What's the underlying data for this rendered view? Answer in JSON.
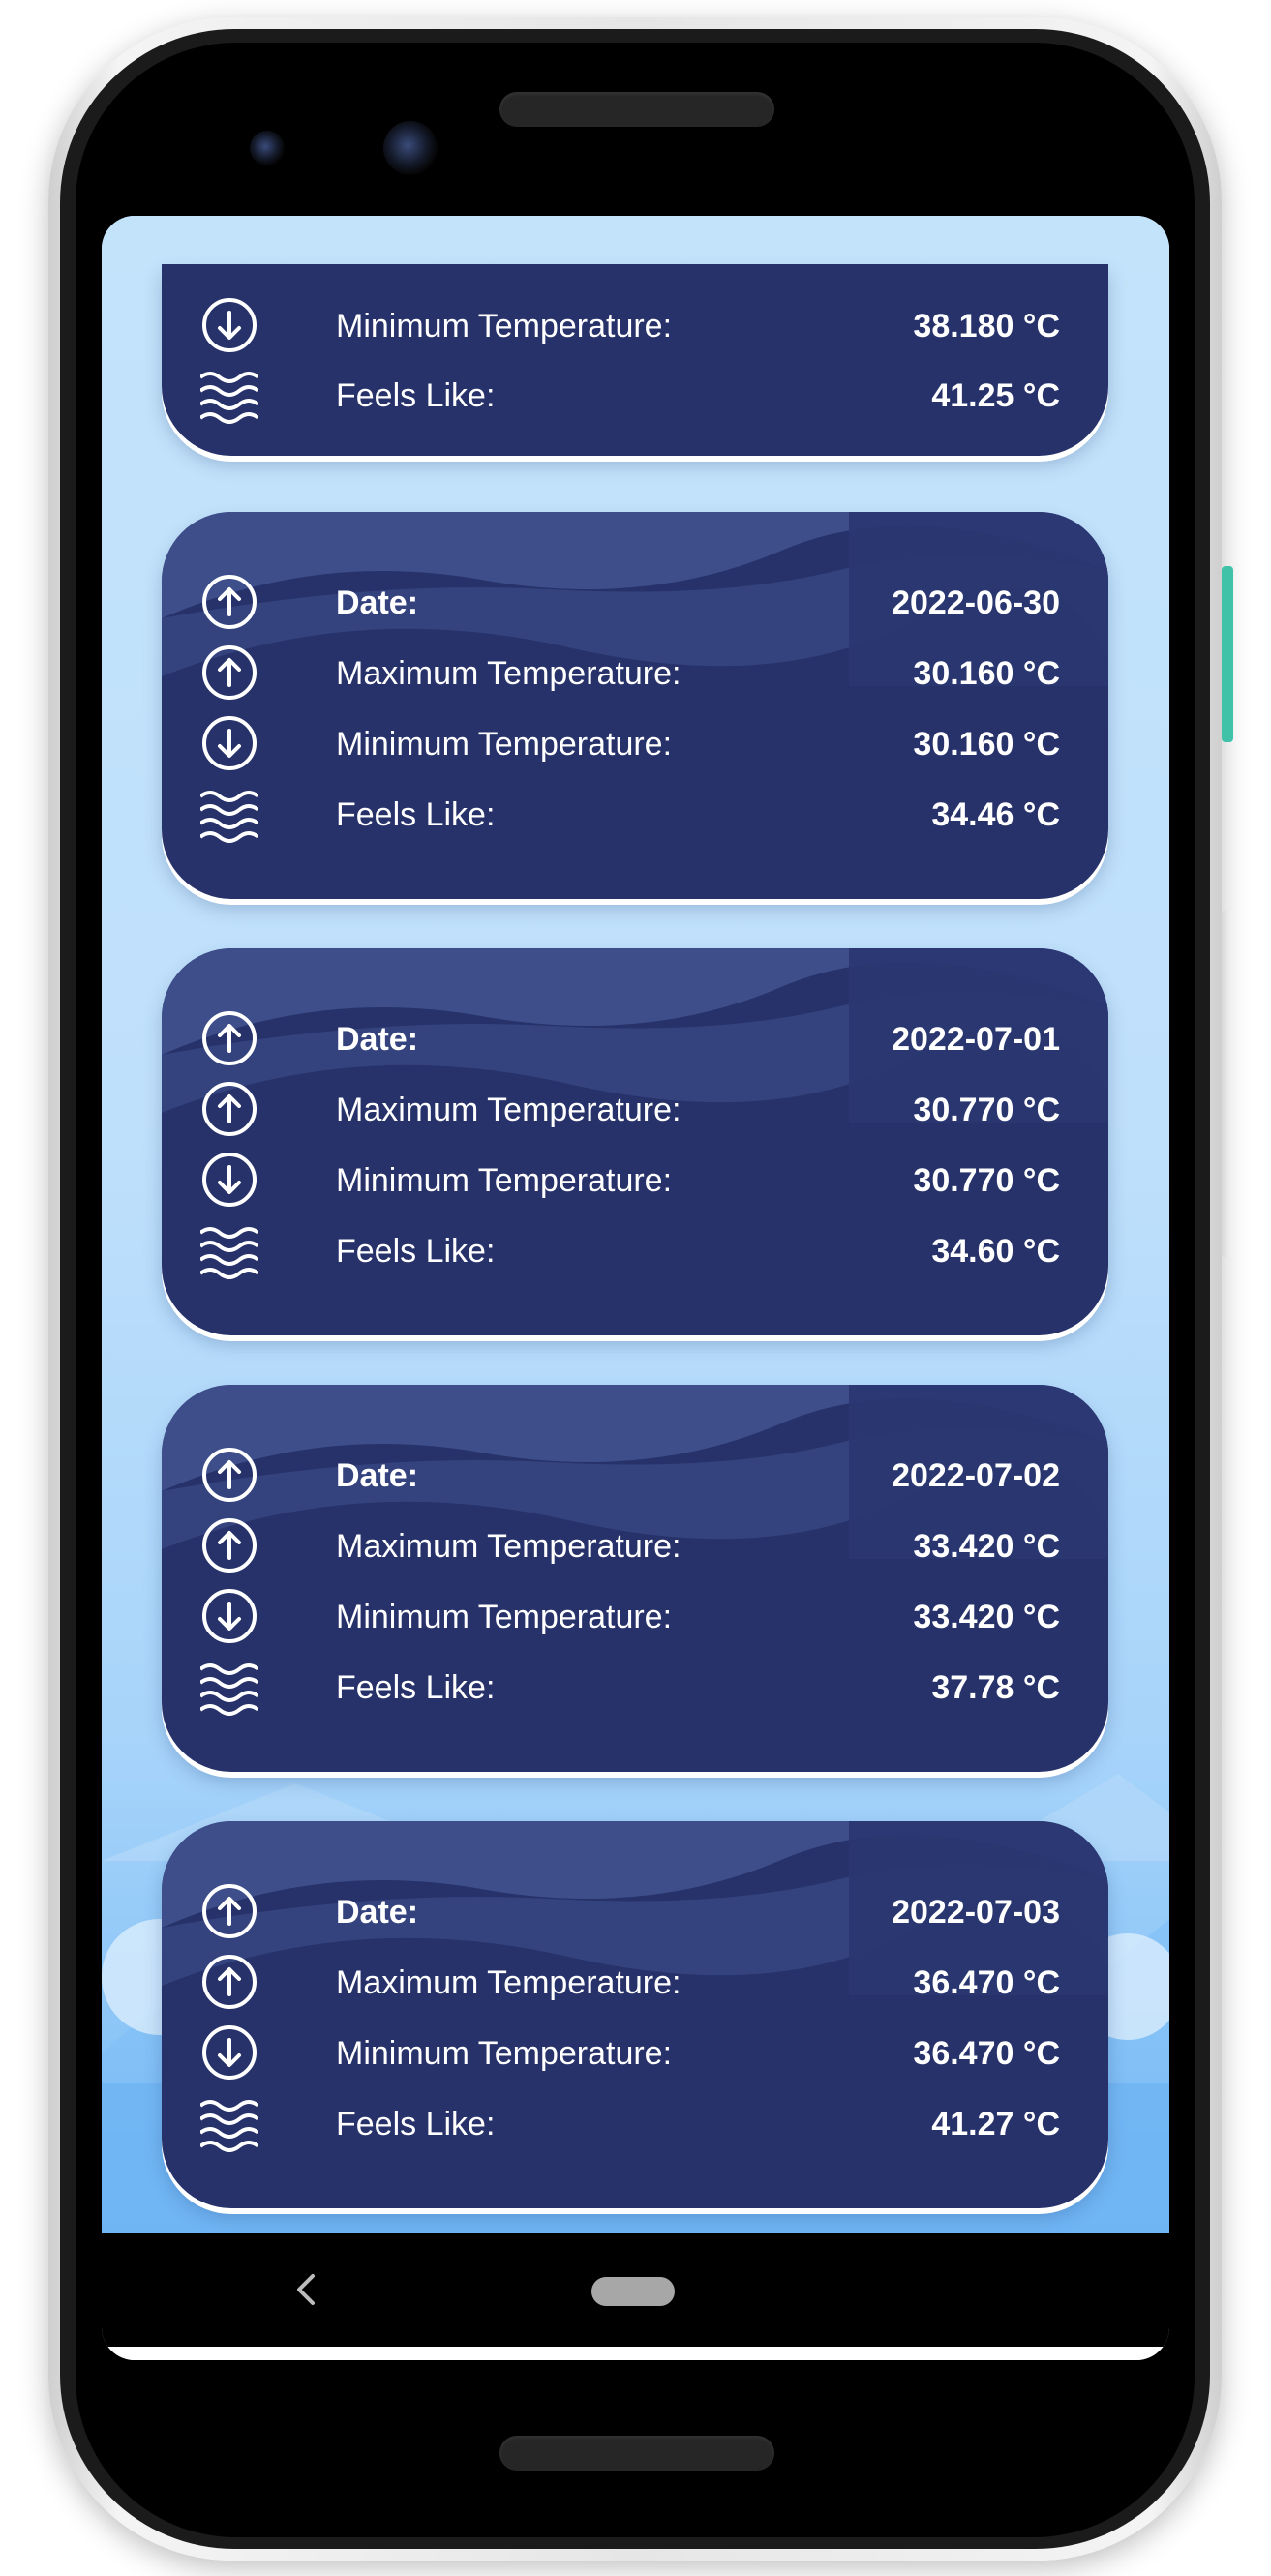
{
  "icons": {
    "date": "arrow-up-circle-icon",
    "max": "arrow-up-circle-icon",
    "min": "arrow-down-circle-icon",
    "feels": "waves-icon",
    "back": "back-chevron-icon",
    "home": "home-pill-icon"
  },
  "colors": {
    "card_background": "#27326a",
    "screen_background": "#bfe0fb",
    "text": "#ffffff"
  },
  "forecast": {
    "partial": {
      "min_label": "Minimum Temperature:",
      "min_value": "38.180 °C",
      "feels_label": "Feels Like:",
      "feels_value": "41.25 °C"
    },
    "cards": [
      {
        "date_label": "Date:",
        "date_value": "2022-06-30",
        "max_label": "Maximum Temperature:",
        "max_value": "30.160 °C",
        "min_label": "Minimum Temperature:",
        "min_value": "30.160 °C",
        "feels_label": "Feels Like:",
        "feels_value": "34.46 °C"
      },
      {
        "date_label": "Date:",
        "date_value": "2022-07-01",
        "max_label": "Maximum Temperature:",
        "max_value": "30.770 °C",
        "min_label": "Minimum Temperature:",
        "min_value": "30.770 °C",
        "feels_label": "Feels Like:",
        "feels_value": "34.60 °C"
      },
      {
        "date_label": "Date:",
        "date_value": "2022-07-02",
        "max_label": "Maximum Temperature:",
        "max_value": "33.420 °C",
        "min_label": "Minimum Temperature:",
        "min_value": "33.420 °C",
        "feels_label": "Feels Like:",
        "feels_value": "37.78 °C"
      },
      {
        "date_label": "Date:",
        "date_value": "2022-07-03",
        "max_label": "Maximum Temperature:",
        "max_value": "36.470 °C",
        "min_label": "Minimum Temperature:",
        "min_value": "36.470 °C",
        "feels_label": "Feels Like:",
        "feels_value": "41.27 °C"
      }
    ]
  }
}
